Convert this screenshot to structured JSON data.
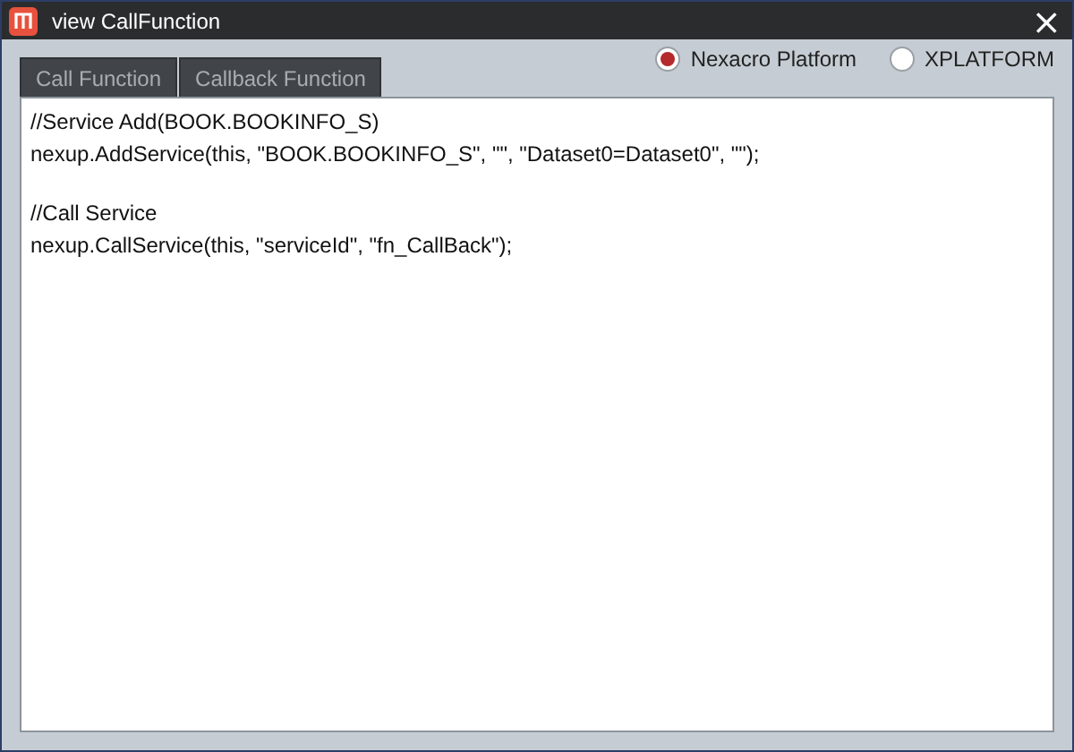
{
  "window": {
    "title": "view CallFunction",
    "close": "×"
  },
  "tabs": [
    {
      "label": "Call Function"
    },
    {
      "label": "Callback Function"
    }
  ],
  "platform_options": [
    {
      "label": "Nexacro Platform",
      "selected": true
    },
    {
      "label": "XPLATFORM",
      "selected": false
    }
  ],
  "code_blocks": [
    [
      "//Service Add(BOOK.BOOKINFO_S)",
      "nexup.AddService(this, \"BOOK.BOOKINFO_S\", \"\", \"Dataset0=Dataset0\", \"\");"
    ],
    [
      "//Call Service",
      "nexup.CallService(this, \"serviceId\", \"fn_CallBack\");"
    ]
  ]
}
